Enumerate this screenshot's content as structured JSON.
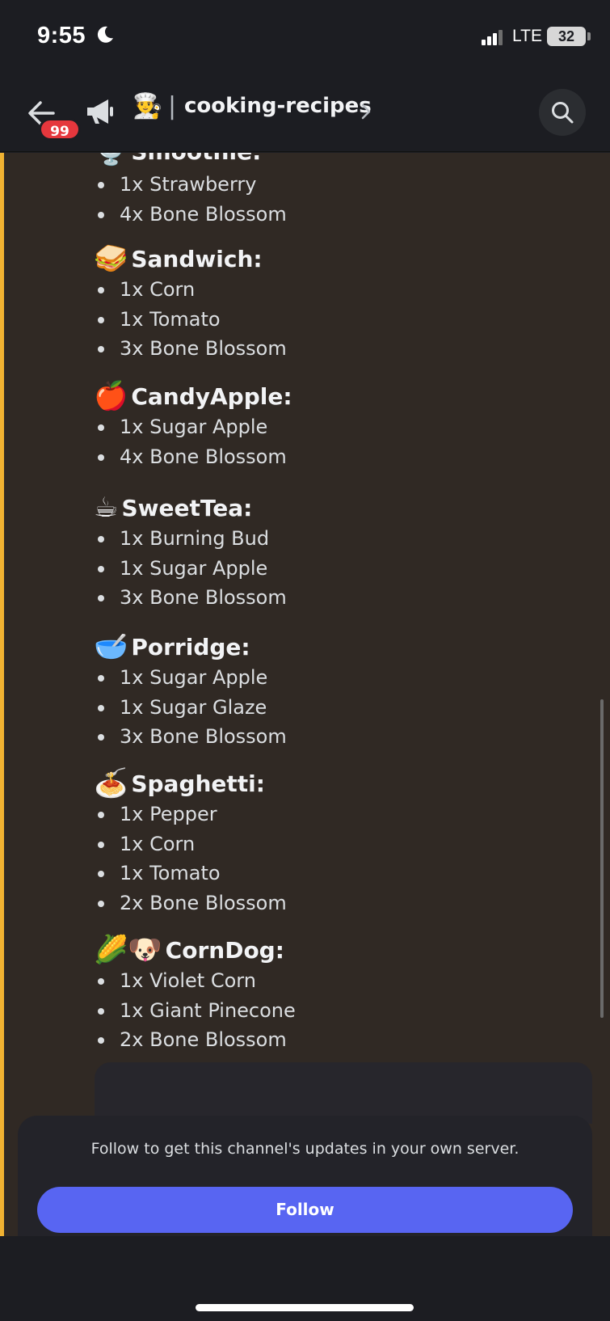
{
  "status_bar": {
    "time": "9:55",
    "network": "LTE",
    "battery": "32"
  },
  "header": {
    "badge_count": "99",
    "channel_emoji": "👨‍🍳",
    "separator": "|",
    "channel_name": "cooking-recipes"
  },
  "partial_recipe": {
    "title": "Smoothie:",
    "emoji": "🍨"
  },
  "recipes": [
    {
      "emoji": "",
      "title": "",
      "ingredients": [
        "1x Strawberry",
        "4x Bone Blossom"
      ]
    },
    {
      "emoji": "🥪",
      "title": "Sandwich:",
      "ingredients": [
        "1x Corn",
        "1x Tomato",
        "3x Bone Blossom"
      ]
    },
    {
      "emoji": "🍎",
      "title": "CandyApple:",
      "ingredients": [
        "1x Sugar Apple",
        "4x Bone Blossom"
      ]
    },
    {
      "emoji": "☕",
      "title": "SweetTea:",
      "ingredients": [
        "1x Burning Bud",
        "1x Sugar Apple",
        "3x Bone Blossom"
      ]
    },
    {
      "emoji": "🥣",
      "title": "Porridge:",
      "ingredients": [
        "1x Sugar Apple",
        "1x Sugar Glaze",
        "3x Bone Blossom"
      ]
    },
    {
      "emoji": "🍝",
      "title": "Spaghetti:",
      "ingredients": [
        "1x Pepper",
        "1x Corn",
        "1x Tomato",
        "2x Bone Blossom"
      ]
    },
    {
      "emoji": "🌽🐶",
      "title": "CornDog:",
      "ingredients": [
        "1x Violet Corn",
        "1x Giant Pinecone",
        "2x Bone Blossom"
      ]
    }
  ],
  "follow": {
    "message": "Follow to get this channel's updates in your own server.",
    "button_label": "Follow"
  }
}
